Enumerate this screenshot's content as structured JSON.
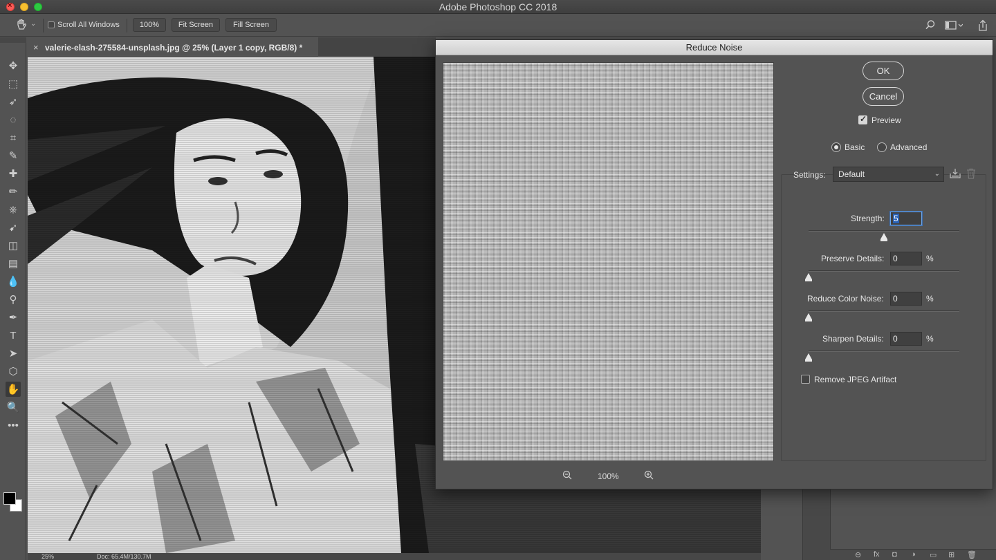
{
  "app_title": "Adobe Photoshop CC 2018",
  "options_bar": {
    "scroll_all_label": "Scroll All Windows",
    "scroll_all_checked": false,
    "zoom_btn": "100%",
    "fit_btn": "Fit Screen",
    "fill_btn": "Fill Screen"
  },
  "document": {
    "tab_title": "valerie-elash-275584-unsplash.jpg @ 25% (Layer 1 copy, RGB/8) *",
    "zoom": "25%",
    "doc_info": "Doc: 65.4M/130.7M"
  },
  "panels_footer": [
    "⊖",
    "fx",
    "◘",
    "◑",
    "▭",
    "⊞",
    "🗑"
  ],
  "dialog": {
    "title": "Reduce Noise",
    "ok": "OK",
    "cancel": "Cancel",
    "preview_label": "Preview",
    "preview_checked": true,
    "mode_basic": "Basic",
    "mode_advanced": "Advanced",
    "mode_selected": "Basic",
    "settings_label": "Settings:",
    "settings_value": "Default",
    "zoom_value": "100%",
    "strength_label": "Strength:",
    "strength_value": "5",
    "strength_fraction": 0.5,
    "preserve_label": "Preserve Details:",
    "preserve_value": "0",
    "preserve_fraction": 0,
    "color_noise_label": "Reduce Color Noise:",
    "color_noise_value": "0",
    "color_noise_fraction": 0,
    "sharpen_label": "Sharpen Details:",
    "sharpen_value": "0",
    "sharpen_fraction": 0,
    "percent": "%",
    "jpeg_label": "Remove JPEG Artifact",
    "jpeg_checked": false
  },
  "tools": [
    "move-tool",
    "marquee-tool",
    "lasso-tool",
    "quick-select-tool",
    "crop-tool",
    "eyedropper-tool",
    "healing-tool",
    "brush-tool",
    "clone-stamp-tool",
    "history-brush-tool",
    "eraser-tool",
    "gradient-tool",
    "blur-tool",
    "dodge-tool",
    "pen-tool",
    "type-tool",
    "path-select-tool",
    "shape-tool",
    "hand-tool",
    "zoom-tool",
    "more-tools"
  ],
  "tool_glyphs": [
    "✥",
    "⬚",
    "➶",
    "◌",
    "⌗",
    "✎",
    "✚",
    "✏",
    "⎈",
    "➹",
    "◫",
    "▤",
    "💧",
    "⚲",
    "✒",
    "T",
    "➤",
    "⬡",
    "✋",
    "🔍",
    "•••"
  ],
  "active_tool": "hand-tool",
  "colors": {
    "foreground": "#000000",
    "background": "#ffffff",
    "accent": "#2a62b5"
  }
}
